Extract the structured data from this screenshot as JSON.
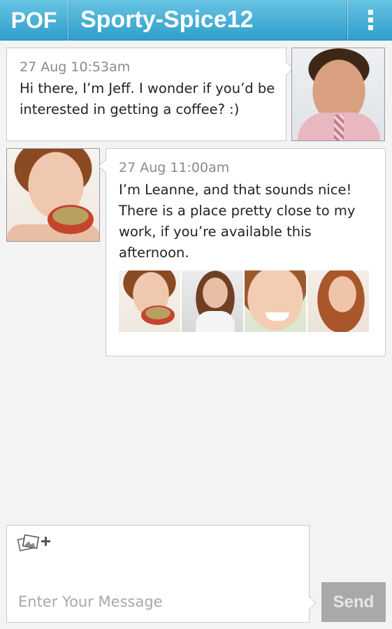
{
  "header": {
    "logo": "POF",
    "title": "Sporty-Spice12",
    "menu_icon": "overflow-menu-icon"
  },
  "colors": {
    "header_top": "#67c3e3",
    "header_bottom": "#2f9fcb",
    "background": "#f3f3f3",
    "send_button": "#a9a9a9"
  },
  "messages": [
    {
      "timestamp": "27 Aug 10:53am",
      "line1": "Hi there, I’m Jeff.  I wonder if you’d be",
      "line2": "interested in getting a coffee? :)",
      "avatar_icon": "avatar-photo"
    },
    {
      "timestamp": "27 Aug 11:00am",
      "line1": "I’m Leanne, and that sounds nice!",
      "line2": "There is a place pretty close to my",
      "line3": "work, if you’re available this afternoon.",
      "avatar_icon": "avatar-photo",
      "photo_count": 4
    }
  ],
  "compose": {
    "placeholder": "Enter Your Message",
    "attach_icon": "attach-photo-icon",
    "send_label": "Send"
  }
}
